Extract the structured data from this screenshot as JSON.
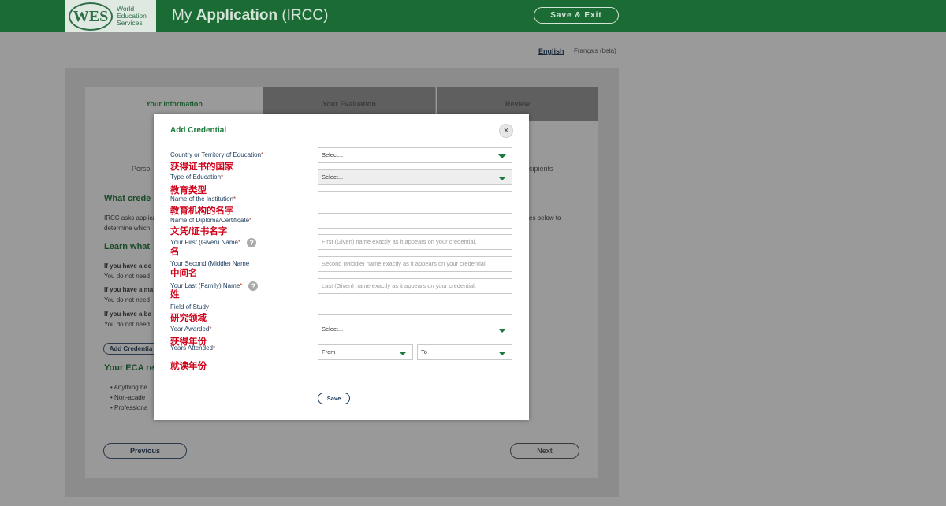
{
  "header": {
    "logo_mark": "WES",
    "logo_line1": "World",
    "logo_line2": "Education",
    "logo_line3": "Services",
    "title_prefix": "My ",
    "title_bold": "Application",
    "title_suffix": " (IRCC)",
    "save_exit": "Save & Exit"
  },
  "language": {
    "english": "English",
    "french": "Français (beta)"
  },
  "tabs": [
    "Your Information",
    "Your Evaluation",
    "Review"
  ],
  "background": {
    "person_fragment": "Perso",
    "recipients_fragment": "cipients",
    "heading1": "What crede",
    "para_line1": "IRCC asks applica",
    "para_line1_end": "es below to",
    "para_line2": "determine which",
    "heading2": "Learn what",
    "if1": "If you have a do",
    "if1_sub": "You do not need",
    "if2": "If you have a ma",
    "if2_sub": "You do not need",
    "if3": "If you have a ba",
    "if3_sub": "You do not need",
    "add_credential": "Add Credentia",
    "heading3": "Your ECA re",
    "bullet1": "Anything be",
    "bullet2": "Non-acade",
    "bullet3": "Professiona",
    "previous": "Previous",
    "next": "Next"
  },
  "modal": {
    "title": "Add Credential",
    "close_symbol": "×",
    "help_symbol": "?",
    "fields": {
      "country": {
        "label": "Country or Territory of Education",
        "zh": "获得证书的国家",
        "value": "Select..."
      },
      "type": {
        "label": "Type of Education",
        "zh": "教育类型",
        "value": "Select..."
      },
      "institution": {
        "label": "Name of the Institution",
        "zh": "教育机构的名字",
        "value": ""
      },
      "diploma": {
        "label": "Name of Diploma/Certificate",
        "zh": "文凭/证书名字",
        "value": ""
      },
      "first_name": {
        "label": "Your First (Given) Name",
        "zh": "名",
        "placeholder": "First (Given) name exactly as it appears on your credential."
      },
      "middle_name": {
        "label": "Your Second (Middle) Name",
        "zh": "中间名",
        "placeholder": "Second (Middle) name exactly as it appears on your credential."
      },
      "last_name": {
        "label": "Your Last (Family) Name",
        "zh": "姓",
        "placeholder": "Last (Given) name exactly as it appears on your credential."
      },
      "field_of_study": {
        "label": "Field of Study",
        "zh": "研究领域",
        "value": ""
      },
      "year_awarded": {
        "label": "Year Awarded",
        "zh": "获得年份",
        "value": "Select..."
      },
      "years_attended": {
        "label": "Years Attended",
        "zh": "就读年份",
        "from": "From",
        "to": "To"
      }
    },
    "required_mark": "*",
    "save": "Save"
  }
}
